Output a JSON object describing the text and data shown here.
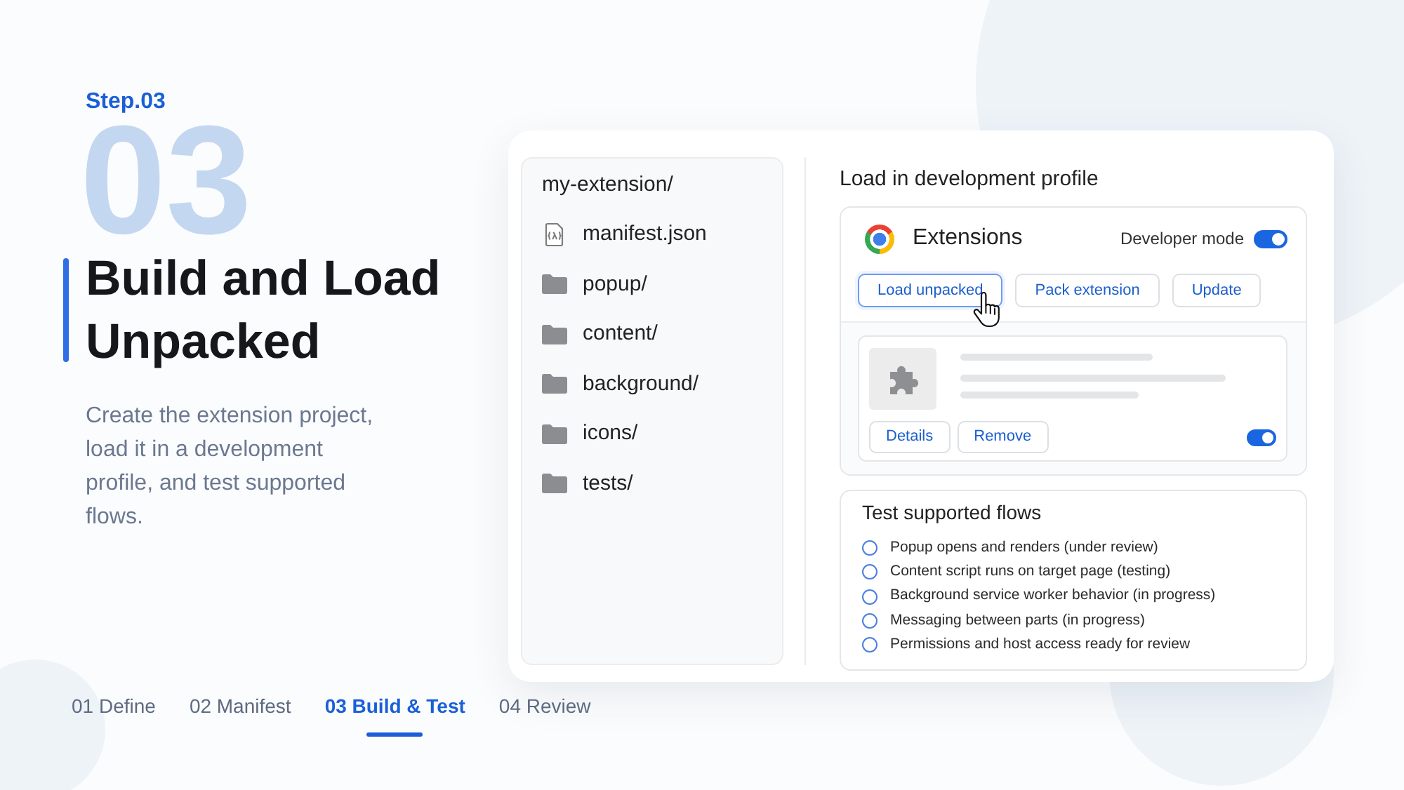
{
  "step": {
    "label": "Step.03",
    "numeral": "03"
  },
  "title": "Build and Load Unpacked",
  "description": "Create the extension project, load it in a development profile, and test supported flows.",
  "file_tree": {
    "root": "my-extension/",
    "children": [
      {
        "name": "manifest.json",
        "kind": "file"
      },
      {
        "name": "popup/",
        "kind": "folder"
      },
      {
        "name": "content/",
        "kind": "folder"
      },
      {
        "name": "background/",
        "kind": "folder"
      },
      {
        "name": "icons/",
        "kind": "folder"
      },
      {
        "name": "tests/",
        "kind": "folder"
      }
    ]
  },
  "dev_profile": {
    "heading": "Load in development profile",
    "panel_title": "Extensions",
    "developer_mode": {
      "label": "Developer mode",
      "on": true
    },
    "buttons": [
      {
        "label": "Load unpacked",
        "hovered": true
      },
      {
        "label": "Pack extension",
        "hovered": false
      },
      {
        "label": "Update",
        "hovered": false
      }
    ],
    "extension": {
      "buttons": [
        "Details",
        "Remove"
      ],
      "on": true
    }
  },
  "test_flows": {
    "heading": "Test supported flows",
    "items": [
      {
        "label": "Popup opens and renders (under review)",
        "checked": false
      },
      {
        "label": "Content script runs on target page (testing)",
        "checked": false
      },
      {
        "label": "Background service worker behavior (in progress)",
        "checked": false
      },
      {
        "label": "Messaging between parts (in progress)",
        "checked": false
      },
      {
        "label": "Permissions and host access ready for review",
        "checked": false
      }
    ]
  },
  "steps_nav": [
    {
      "label": "01 Define",
      "selected": false
    },
    {
      "label": "02 Manifest",
      "selected": false
    },
    {
      "label": "03 Build & Test",
      "selected": true
    },
    {
      "label": "04 Review",
      "selected": false
    }
  ]
}
